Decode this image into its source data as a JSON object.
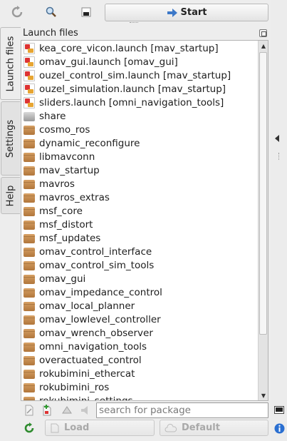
{
  "toolbar": {
    "start_label": "Start",
    "refresh_icon": "refresh-icon",
    "search_icon": "magnifier-icon",
    "terminal_icon": "terminal-icon"
  },
  "tabs": [
    {
      "label": "Launch files",
      "active": true
    },
    {
      "label": "Settings",
      "active": false
    },
    {
      "label": "Help",
      "active": false
    }
  ],
  "panel": {
    "title": "Launch files"
  },
  "items": [
    {
      "type": "launch",
      "label": "kea_core_vicon.launch   [mav_startup]"
    },
    {
      "type": "launch",
      "label": "omav_gui.launch   [omav_gui]"
    },
    {
      "type": "launch",
      "label": "ouzel_control_sim.launch   [mav_startup]"
    },
    {
      "type": "launch",
      "label": "ouzel_simulation.launch   [mav_startup]"
    },
    {
      "type": "launch",
      "label": "sliders.launch   [omni_navigation_tools]"
    },
    {
      "type": "share",
      "label": "share"
    },
    {
      "type": "folder",
      "label": "cosmo_ros"
    },
    {
      "type": "folder",
      "label": "dynamic_reconfigure"
    },
    {
      "type": "folder",
      "label": "libmavconn"
    },
    {
      "type": "folder",
      "label": "mav_startup"
    },
    {
      "type": "folder",
      "label": "mavros"
    },
    {
      "type": "folder",
      "label": "mavros_extras"
    },
    {
      "type": "folder",
      "label": "msf_core"
    },
    {
      "type": "folder",
      "label": "msf_distort"
    },
    {
      "type": "folder",
      "label": "msf_updates"
    },
    {
      "type": "folder",
      "label": "omav_control_interface"
    },
    {
      "type": "folder",
      "label": "omav_control_sim_tools"
    },
    {
      "type": "folder",
      "label": "omav_gui"
    },
    {
      "type": "folder",
      "label": "omav_impedance_control"
    },
    {
      "type": "folder",
      "label": "omav_local_planner"
    },
    {
      "type": "folder",
      "label": "omav_lowlevel_controller"
    },
    {
      "type": "folder",
      "label": "omav_wrench_observer"
    },
    {
      "type": "folder",
      "label": "omni_navigation_tools"
    },
    {
      "type": "folder",
      "label": "overactuated_control"
    },
    {
      "type": "folder",
      "label": "rokubimini_ethercat"
    },
    {
      "type": "folder",
      "label": "rokubimini_ros"
    },
    {
      "type": "folder",
      "label": "rokubimini_settings"
    }
  ],
  "bottom": {
    "search_placeholder": "search for package",
    "load_label": "Load",
    "default_label": "Default"
  },
  "colors": {
    "background": "#ededed",
    "list_background": "#ffffff",
    "disabled_text": "#a9a9a9",
    "refresh_green": "#2e8b2e",
    "info_blue": "#2a6fd1"
  }
}
